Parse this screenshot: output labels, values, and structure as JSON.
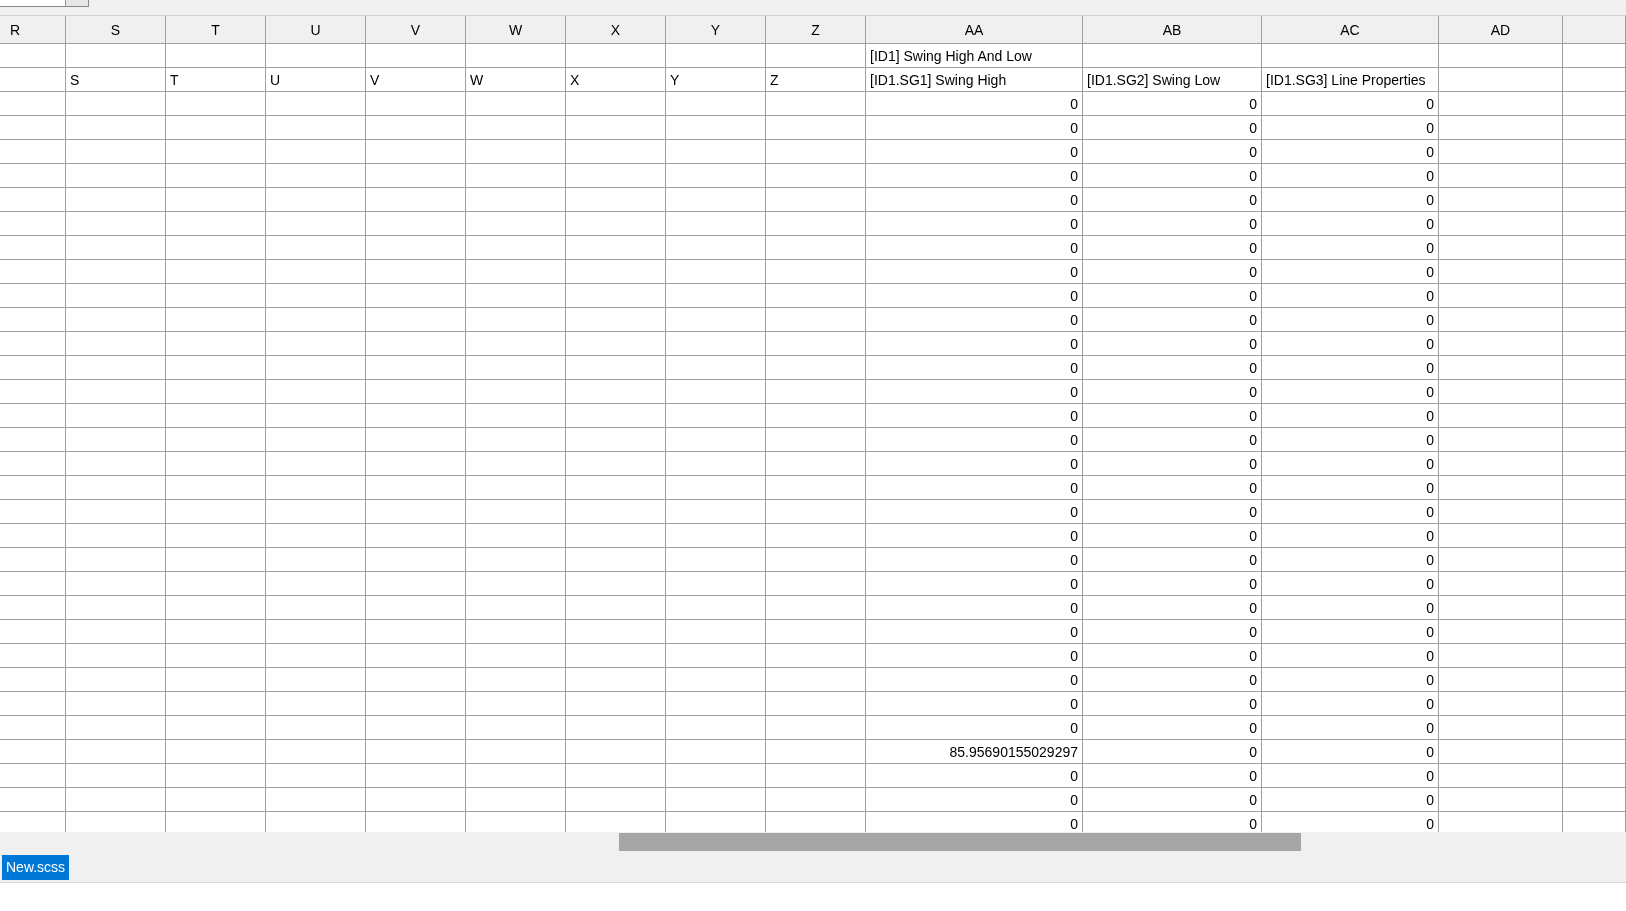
{
  "columns": [
    {
      "header": "R"
    },
    {
      "header": "S"
    },
    {
      "header": "T"
    },
    {
      "header": "U"
    },
    {
      "header": "V"
    },
    {
      "header": "W"
    },
    {
      "header": "X"
    },
    {
      "header": "Y"
    },
    {
      "header": "Z"
    },
    {
      "header": "AA"
    },
    {
      "header": "AB"
    },
    {
      "header": "AC"
    },
    {
      "header": "AD"
    },
    {}
  ],
  "rows": [
    {
      "kind": "labels",
      "cells": [
        null,
        null,
        null,
        null,
        null,
        null,
        null,
        null,
        null,
        "[ID1] Swing High And Low",
        null,
        null,
        null,
        null
      ]
    },
    {
      "kind": "labels",
      "cells": [
        null,
        "S",
        "T",
        "U",
        "V",
        "W",
        "X",
        "Y",
        "Z",
        "[ID1.SG1] Swing High",
        "[ID1.SG2] Swing Low",
        "[ID1.SG3] Line Properties",
        null,
        null
      ]
    },
    {
      "kind": "values",
      "cells": [
        null,
        null,
        null,
        null,
        null,
        null,
        null,
        null,
        null,
        "0",
        "0",
        "0",
        null,
        null
      ]
    },
    {
      "kind": "values",
      "cells": [
        null,
        null,
        null,
        null,
        null,
        null,
        null,
        null,
        null,
        "0",
        "0",
        "0",
        null,
        null
      ]
    },
    {
      "kind": "values",
      "cells": [
        null,
        null,
        null,
        null,
        null,
        null,
        null,
        null,
        null,
        "0",
        "0",
        "0",
        null,
        null
      ]
    },
    {
      "kind": "values",
      "cells": [
        null,
        null,
        null,
        null,
        null,
        null,
        null,
        null,
        null,
        "0",
        "0",
        "0",
        null,
        null
      ]
    },
    {
      "kind": "values",
      "cells": [
        null,
        null,
        null,
        null,
        null,
        null,
        null,
        null,
        null,
        "0",
        "0",
        "0",
        null,
        null
      ]
    },
    {
      "kind": "values",
      "cells": [
        null,
        null,
        null,
        null,
        null,
        null,
        null,
        null,
        null,
        "0",
        "0",
        "0",
        null,
        null
      ]
    },
    {
      "kind": "values",
      "cells": [
        null,
        null,
        null,
        null,
        null,
        null,
        null,
        null,
        null,
        "0",
        "0",
        "0",
        null,
        null
      ]
    },
    {
      "kind": "values",
      "cells": [
        null,
        null,
        null,
        null,
        null,
        null,
        null,
        null,
        null,
        "0",
        "0",
        "0",
        null,
        null
      ]
    },
    {
      "kind": "values",
      "cells": [
        null,
        null,
        null,
        null,
        null,
        null,
        null,
        null,
        null,
        "0",
        "0",
        "0",
        null,
        null
      ]
    },
    {
      "kind": "values",
      "cells": [
        null,
        null,
        null,
        null,
        null,
        null,
        null,
        null,
        null,
        "0",
        "0",
        "0",
        null,
        null
      ]
    },
    {
      "kind": "values",
      "cells": [
        null,
        null,
        null,
        null,
        null,
        null,
        null,
        null,
        null,
        "0",
        "0",
        "0",
        null,
        null
      ]
    },
    {
      "kind": "values",
      "cells": [
        null,
        null,
        null,
        null,
        null,
        null,
        null,
        null,
        null,
        "0",
        "0",
        "0",
        null,
        null
      ]
    },
    {
      "kind": "values",
      "cells": [
        null,
        null,
        null,
        null,
        null,
        null,
        null,
        null,
        null,
        "0",
        "0",
        "0",
        null,
        null
      ]
    },
    {
      "kind": "values",
      "cells": [
        null,
        null,
        null,
        null,
        null,
        null,
        null,
        null,
        null,
        "0",
        "0",
        "0",
        null,
        null
      ]
    },
    {
      "kind": "values",
      "cells": [
        null,
        null,
        null,
        null,
        null,
        null,
        null,
        null,
        null,
        "0",
        "0",
        "0",
        null,
        null
      ]
    },
    {
      "kind": "values",
      "cells": [
        null,
        null,
        null,
        null,
        null,
        null,
        null,
        null,
        null,
        "0",
        "0",
        "0",
        null,
        null
      ]
    },
    {
      "kind": "values",
      "cells": [
        null,
        null,
        null,
        null,
        null,
        null,
        null,
        null,
        null,
        "0",
        "0",
        "0",
        null,
        null
      ]
    },
    {
      "kind": "values",
      "cells": [
        null,
        null,
        null,
        null,
        null,
        null,
        null,
        null,
        null,
        "0",
        "0",
        "0",
        null,
        null
      ]
    },
    {
      "kind": "values",
      "cells": [
        null,
        null,
        null,
        null,
        null,
        null,
        null,
        null,
        null,
        "0",
        "0",
        "0",
        null,
        null
      ]
    },
    {
      "kind": "values",
      "cells": [
        null,
        null,
        null,
        null,
        null,
        null,
        null,
        null,
        null,
        "0",
        "0",
        "0",
        null,
        null
      ]
    },
    {
      "kind": "values",
      "cells": [
        null,
        null,
        null,
        null,
        null,
        null,
        null,
        null,
        null,
        "0",
        "0",
        "0",
        null,
        null
      ]
    },
    {
      "kind": "values",
      "cells": [
        null,
        null,
        null,
        null,
        null,
        null,
        null,
        null,
        null,
        "0",
        "0",
        "0",
        null,
        null
      ]
    },
    {
      "kind": "values",
      "cells": [
        null,
        null,
        null,
        null,
        null,
        null,
        null,
        null,
        null,
        "0",
        "0",
        "0",
        null,
        null
      ]
    },
    {
      "kind": "values",
      "cells": [
        null,
        null,
        null,
        null,
        null,
        null,
        null,
        null,
        null,
        "0",
        "0",
        "0",
        null,
        null
      ]
    },
    {
      "kind": "values",
      "cells": [
        null,
        null,
        null,
        null,
        null,
        null,
        null,
        null,
        null,
        "0",
        "0",
        "0",
        null,
        null
      ]
    },
    {
      "kind": "values",
      "cells": [
        null,
        null,
        null,
        null,
        null,
        null,
        null,
        null,
        null,
        "0",
        "0",
        "0",
        null,
        null
      ]
    },
    {
      "kind": "values",
      "cells": [
        null,
        null,
        null,
        null,
        null,
        null,
        null,
        null,
        null,
        "0",
        "0",
        "0",
        null,
        null
      ]
    },
    {
      "kind": "values",
      "cells": [
        null,
        null,
        null,
        null,
        null,
        null,
        null,
        null,
        null,
        "85.95690155029297",
        "0",
        "0",
        null,
        null
      ]
    },
    {
      "kind": "values",
      "cells": [
        null,
        null,
        null,
        null,
        null,
        null,
        null,
        null,
        null,
        "0",
        "0",
        "0",
        null,
        null
      ]
    },
    {
      "kind": "values",
      "cells": [
        null,
        null,
        null,
        null,
        null,
        null,
        null,
        null,
        null,
        "0",
        "0",
        "0",
        null,
        null
      ]
    },
    {
      "kind": "values",
      "cells": [
        null,
        null,
        null,
        null,
        null,
        null,
        null,
        null,
        null,
        "0",
        "0",
        "0",
        null,
        null
      ]
    }
  ],
  "sheet_tabs": [
    {
      "label": "New.scss",
      "selected": true
    }
  ]
}
